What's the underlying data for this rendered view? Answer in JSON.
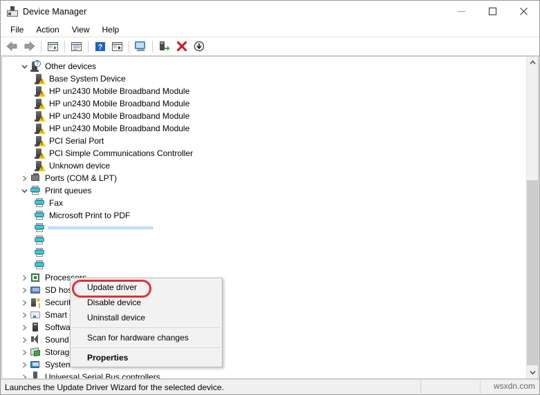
{
  "window": {
    "title": "Device Manager",
    "icon": "device-manager-icon",
    "controls": {
      "minimize": "minimize-icon",
      "maximize": "maximize-icon",
      "close": "close-icon"
    }
  },
  "menubar": {
    "items": [
      {
        "label": "File"
      },
      {
        "label": "Action"
      },
      {
        "label": "View"
      },
      {
        "label": "Help"
      }
    ]
  },
  "toolbar": {
    "buttons": [
      {
        "name": "back-icon"
      },
      {
        "name": "forward-icon"
      },
      {
        "name": "separator"
      },
      {
        "name": "show-hide-console-tree-icon"
      },
      {
        "name": "separator"
      },
      {
        "name": "properties-icon"
      },
      {
        "name": "separator"
      },
      {
        "name": "help-icon"
      },
      {
        "name": "show-hide-action-pane-icon"
      },
      {
        "name": "separator"
      },
      {
        "name": "scan-for-hardware-changes-icon"
      },
      {
        "name": "separator"
      },
      {
        "name": "update-driver-icon"
      },
      {
        "name": "uninstall-device-icon"
      },
      {
        "name": "disable-device-icon"
      }
    ]
  },
  "tree": {
    "rows": [
      {
        "label": "Other devices",
        "indent": 0,
        "expander": "expanded",
        "icon": "device-unknown-icon"
      },
      {
        "label": "Base System Device",
        "indent": 1,
        "expander": "none",
        "icon": "device-warning-icon"
      },
      {
        "label": "HP un2430 Mobile Broadband Module",
        "indent": 1,
        "expander": "none",
        "icon": "device-warning-icon"
      },
      {
        "label": "HP un2430 Mobile Broadband Module",
        "indent": 1,
        "expander": "none",
        "icon": "device-warning-icon"
      },
      {
        "label": "HP un2430 Mobile Broadband Module",
        "indent": 1,
        "expander": "none",
        "icon": "device-warning-icon"
      },
      {
        "label": "HP un2430 Mobile Broadband Module",
        "indent": 1,
        "expander": "none",
        "icon": "device-warning-icon"
      },
      {
        "label": "PCI Serial Port",
        "indent": 1,
        "expander": "none",
        "icon": "device-warning-icon"
      },
      {
        "label": "PCI Simple Communications Controller",
        "indent": 1,
        "expander": "none",
        "icon": "device-warning-icon"
      },
      {
        "label": "Unknown device",
        "indent": 1,
        "expander": "none",
        "icon": "device-warning-icon"
      },
      {
        "label": "Ports (COM & LPT)",
        "indent": 0,
        "expander": "collapsed",
        "icon": "port-icon"
      },
      {
        "label": "Print queues",
        "indent": 0,
        "expander": "expanded",
        "icon": "printer-icon"
      },
      {
        "label": "Fax",
        "indent": 1,
        "expander": "none",
        "icon": "printer-icon"
      },
      {
        "label": "Microsoft Print to PDF",
        "indent": 1,
        "expander": "none",
        "icon": "printer-icon"
      },
      {
        "label": "",
        "indent": 1,
        "expander": "none",
        "icon": "printer-icon",
        "selected": true
      },
      {
        "label": "",
        "indent": 1,
        "expander": "none",
        "icon": "printer-icon"
      },
      {
        "label": "",
        "indent": 1,
        "expander": "none",
        "icon": "printer-icon"
      },
      {
        "label": "",
        "indent": 1,
        "expander": "none",
        "icon": "printer-icon"
      },
      {
        "label": "Processors",
        "indent": 0,
        "expander": "collapsed",
        "icon": "processor-icon"
      },
      {
        "label": "SD host adapters",
        "indent": 0,
        "expander": "collapsed",
        "icon": "sd-host-icon"
      },
      {
        "label": "Security devices",
        "indent": 0,
        "expander": "collapsed",
        "icon": "security-device-icon"
      },
      {
        "label": "Smart card readers",
        "indent": 0,
        "expander": "collapsed",
        "icon": "smart-card-reader-icon"
      },
      {
        "label": "Software devices",
        "indent": 0,
        "expander": "collapsed",
        "icon": "software-device-icon"
      },
      {
        "label": "Sound, video and game controllers",
        "indent": 0,
        "expander": "collapsed",
        "icon": "sound-controller-icon"
      },
      {
        "label": "Storage controllers",
        "indent": 0,
        "expander": "collapsed",
        "icon": "storage-controller-icon"
      },
      {
        "label": "System devices",
        "indent": 0,
        "expander": "collapsed",
        "icon": "system-device-icon"
      },
      {
        "label": "Universal Serial Bus controllers",
        "indent": 0,
        "expander": "collapsed",
        "icon": "usb-controller-icon"
      }
    ]
  },
  "context_menu": {
    "items": [
      {
        "label": "Update driver",
        "bold": false,
        "highlighted": true
      },
      {
        "label": "Disable device",
        "bold": false
      },
      {
        "label": "Uninstall device",
        "bold": false
      },
      {
        "separator": true
      },
      {
        "label": "Scan for hardware changes",
        "bold": false
      },
      {
        "separator": true
      },
      {
        "label": "Properties",
        "bold": true
      }
    ],
    "highlight_color": "#e03030"
  },
  "statusbar": {
    "text": "Launches the Update Driver Wizard for the selected device.",
    "watermark": "wsxdn.com"
  }
}
